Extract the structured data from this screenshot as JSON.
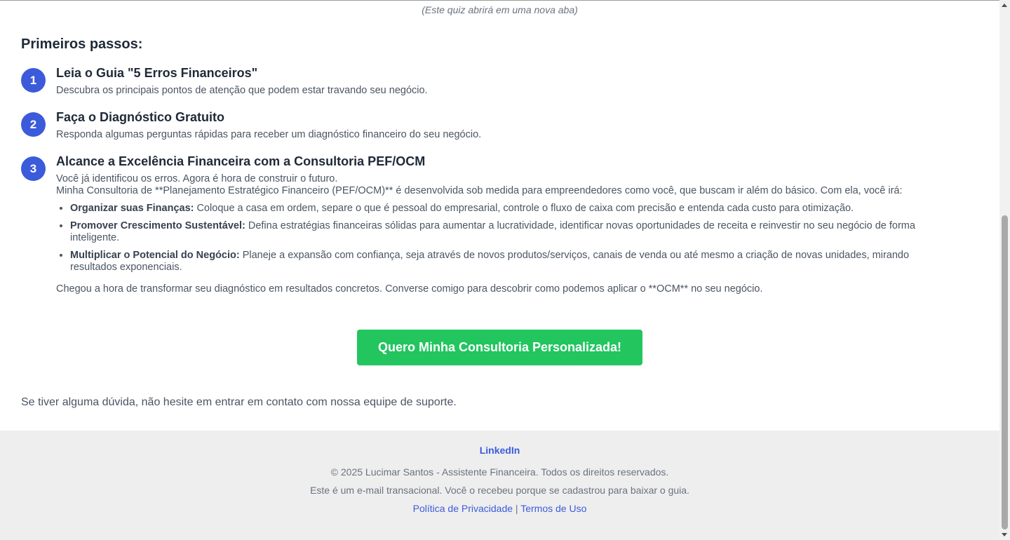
{
  "quiz_note": "(Este quiz abrirá em uma nova aba)",
  "steps_heading": "Primeiros passos:",
  "steps": [
    {
      "number": "1",
      "title": "Leia o Guia \"5 Erros Financeiros\"",
      "description": "Descubra os principais pontos de atenção que podem estar travando seu negócio."
    },
    {
      "number": "2",
      "title": "Faça o Diagnóstico Gratuito",
      "description": "Responda algumas perguntas rápidas para receber um diagnóstico financeiro do seu negócio."
    },
    {
      "number": "3",
      "title": "Alcance a Excelência Financeira com a Consultoria PEF/OCM",
      "intro_line1": "Você já identificou os erros. Agora é hora de construir o futuro.",
      "intro_line2": "Minha Consultoria de **Planejamento Estratégico Financeiro (PEF/OCM)** é desenvolvida sob medida para empreendedores como você, que buscam ir além do básico. Com ela, você irá:",
      "bullets": [
        {
          "label": "Organizar suas Finanças:",
          "text": " Coloque a casa em ordem, separe o que é pessoal do empresarial, controle o fluxo de caixa com precisão e entenda cada custo para otimização."
        },
        {
          "label": "Promover Crescimento Sustentável:",
          "text": " Defina estratégias financeiras sólidas para aumentar a lucratividade, identificar novas oportunidades de receita e reinvestir no seu negócio de forma inteligente."
        },
        {
          "label": "Multiplicar o Potencial do Negócio:",
          "text": " Planeje a expansão com confiança, seja através de novos produtos/serviços, canais de venda ou até mesmo a criação de novas unidades, mirando resultados exponenciais."
        }
      ],
      "closing": "Chegou a hora de transformar seu diagnóstico em resultados concretos. Converse comigo para descobrir como podemos aplicar o **OCM** no seu negócio."
    }
  ],
  "cta_label": "Quero Minha Consultoria Personalizada!",
  "support_text": "Se tiver alguma dúvida, não hesite em entrar em contato com nossa equipe de suporte.",
  "footer": {
    "linkedin": "LinkedIn",
    "copyright": "© 2025 Lucimar Santos - Assistente Financeira. Todos os direitos reservados.",
    "transactional": "Este é um e-mail transacional. Você o recebeu porque se cadastrou para baixar o guia.",
    "privacy": "Política de Privacidade",
    "separator": " | ",
    "terms": "Termos de Uso"
  },
  "colors": {
    "accent": "#3b5bdb",
    "cta": "#22c55e"
  }
}
